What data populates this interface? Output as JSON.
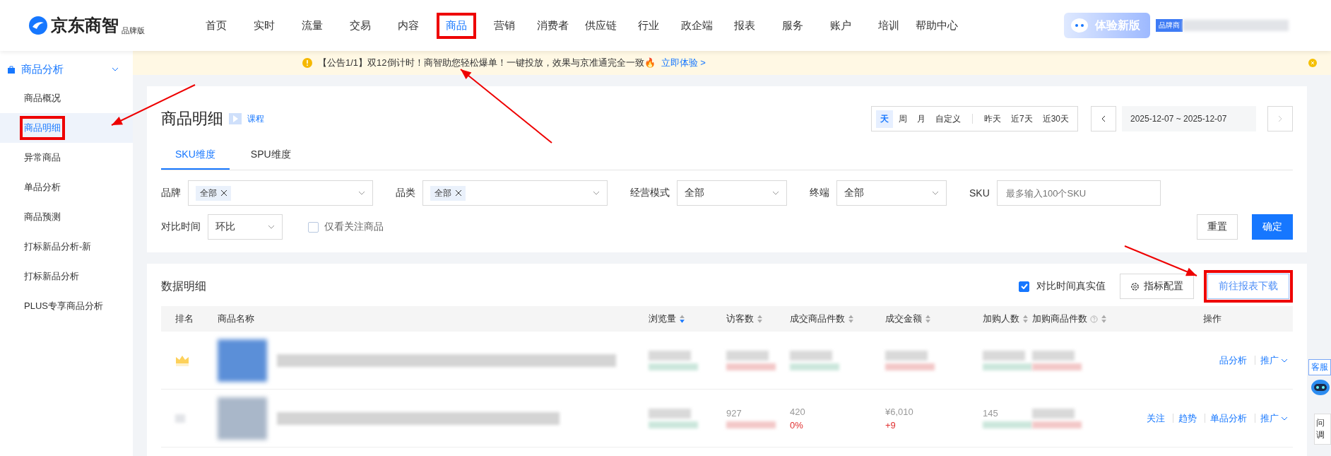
{
  "header": {
    "logo": "京东商智",
    "edition": "品牌版",
    "nav": [
      {
        "label": "首页",
        "selected": false,
        "annotated": false
      },
      {
        "label": "实时",
        "selected": false,
        "annotated": false
      },
      {
        "label": "流量",
        "selected": false,
        "annotated": false
      },
      {
        "label": "交易",
        "selected": false,
        "annotated": false
      },
      {
        "label": "内容",
        "selected": false,
        "annotated": false
      },
      {
        "label": "商品",
        "selected": true,
        "annotated": true
      },
      {
        "label": "营销",
        "selected": false,
        "annotated": false
      },
      {
        "label": "消费者",
        "selected": false,
        "annotated": false
      },
      {
        "label": "供应链",
        "selected": false,
        "annotated": false
      },
      {
        "label": "行业",
        "selected": false,
        "annotated": false
      },
      {
        "label": "政企端",
        "selected": false,
        "annotated": false
      },
      {
        "label": "报表",
        "selected": false,
        "annotated": false
      },
      {
        "label": "服务",
        "selected": false,
        "annotated": false
      },
      {
        "label": "账户",
        "selected": false,
        "annotated": false
      },
      {
        "label": "培训",
        "selected": false,
        "annotated": false
      },
      {
        "label": "帮助中心",
        "selected": false,
        "annotated": false
      }
    ],
    "try_button": "体验新版",
    "account_tag": "品牌商"
  },
  "sidebar": {
    "group": {
      "label": "商品分析",
      "expanded": true
    },
    "items": [
      {
        "label": "商品概况",
        "selected": false,
        "annotated": false
      },
      {
        "label": "商品明细",
        "selected": true,
        "annotated": true
      },
      {
        "label": "异常商品",
        "selected": false,
        "annotated": false
      },
      {
        "label": "单品分析",
        "selected": false,
        "annotated": false
      },
      {
        "label": "商品预测",
        "selected": false,
        "annotated": false
      },
      {
        "label": "打标新品分析-新",
        "selected": false,
        "annotated": false
      },
      {
        "label": "打标新品分析",
        "selected": false,
        "annotated": false
      },
      {
        "label": "PLUS专享商品分析",
        "selected": false,
        "annotated": false
      }
    ]
  },
  "notice": {
    "text": "【公告1/1】双12倒计时！商智助您轻松爆单！一键投放，效果与京准通完全一致🔥",
    "link": "立即体验 >"
  },
  "title": "商品明细",
  "course": "课程",
  "periods": [
    {
      "label": "天",
      "selected": true
    },
    {
      "label": "周",
      "selected": false
    },
    {
      "label": "月",
      "selected": false
    },
    {
      "label": "自定义",
      "selected": false
    }
  ],
  "quick_ranges": [
    {
      "label": "昨天",
      "selected": false
    },
    {
      "label": "近7天",
      "selected": false
    },
    {
      "label": "近30天",
      "selected": false
    }
  ],
  "date_value": "2025-12-07 ~ 2025-12-07",
  "dimension_tabs": [
    {
      "label": "SKU维度",
      "selected": true
    },
    {
      "label": "SPU维度",
      "selected": false
    }
  ],
  "filters": [
    {
      "kind": "tags",
      "label": "品牌",
      "tags": [
        "全部"
      ]
    },
    {
      "kind": "tags",
      "label": "品类",
      "tags": [
        "全部"
      ]
    },
    {
      "kind": "select",
      "label": "经营模式",
      "value": "全部"
    },
    {
      "kind": "select",
      "label": "终端",
      "value": "全部"
    },
    {
      "kind": "input",
      "label": "SKU",
      "placeholder": "最多输入100个SKU"
    }
  ],
  "compare": {
    "label": "对比时间",
    "value": "环比"
  },
  "follow_only": {
    "label": "仅看关注商品",
    "checked": false
  },
  "reset_button": "重置",
  "confirm_button": "确定",
  "details": {
    "title": "数据明细",
    "real_value": {
      "label": "对比时间真实值",
      "checked": true
    },
    "config_button": "指标配置",
    "download_button": {
      "label": "前往报表下载",
      "annotated": true
    }
  },
  "table": {
    "columns": [
      {
        "label": "排名"
      },
      {
        "label": "商品名称"
      },
      {
        "label": "浏览量",
        "sorted": true
      },
      {
        "label": "访客数",
        "sorted": false
      },
      {
        "label": "成交商品件数",
        "sorted": false
      },
      {
        "label": "成交金额",
        "sorted": false
      },
      {
        "label": "加购人数",
        "sorted": false
      },
      {
        "label": "加购商品件数",
        "sorted": false,
        "help": true
      },
      {
        "label": "操作"
      }
    ],
    "rows": [
      {
        "top_rank": true,
        "metrics": [
          {
            "blurred": true
          },
          {
            "blurred": true
          },
          {
            "blurred": true
          },
          {
            "blurred": true
          },
          {
            "blurred": true
          },
          {
            "blurred": true
          }
        ],
        "actions": [
          "品分析",
          "推广"
        ]
      },
      {
        "top_rank": false,
        "metrics": [
          {
            "blurred": true
          },
          {
            "value": "927"
          },
          {
            "value": "420",
            "change": "0%"
          },
          {
            "value": "¥6,010",
            "change": "+9"
          },
          {
            "value": "145"
          },
          {
            "blurred": true
          }
        ],
        "actions": [
          "关注",
          "趋势",
          "单品分析",
          "推广"
        ]
      }
    ]
  },
  "side_widgets": {
    "service": "客服",
    "survey": [
      "问",
      "调"
    ]
  }
}
